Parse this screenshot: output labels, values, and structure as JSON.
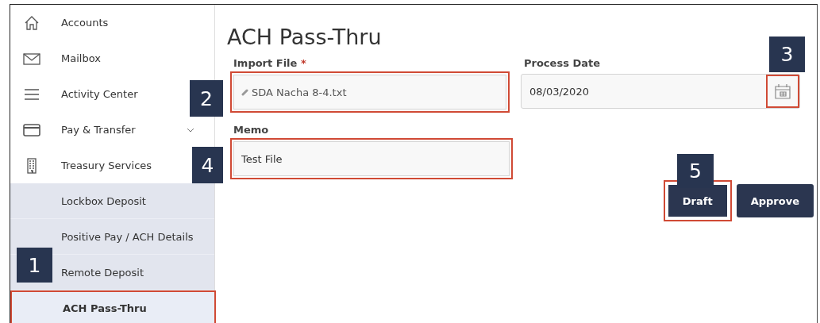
{
  "sidebar": {
    "items": [
      {
        "label": "Accounts",
        "selected": false,
        "highlighted": false
      },
      {
        "label": "Mailbox",
        "selected": false,
        "highlighted": false
      },
      {
        "label": "Activity Center",
        "selected": false,
        "highlighted": false
      },
      {
        "label": "Pay & Transfer",
        "selected": false,
        "highlighted": false,
        "expanded": false
      },
      {
        "label": "Treasury Services",
        "selected": false,
        "highlighted": false,
        "expanded": true,
        "children": [
          {
            "label": "Lockbox Deposit",
            "selected": false,
            "highlighted": false
          },
          {
            "label": "Positive Pay / ACH Details",
            "selected": false,
            "highlighted": false
          },
          {
            "label": "Remote Deposit",
            "selected": false,
            "highlighted": false
          },
          {
            "label": "ACH Pass-Thru",
            "selected": true,
            "highlighted": true
          }
        ]
      }
    ]
  },
  "page": {
    "title": "ACH Pass-Thru"
  },
  "form": {
    "import_file": {
      "label": "Import File",
      "required_mark": "*",
      "value": "SDA Nacha 8-4.txt",
      "highlighted": true
    },
    "process_date": {
      "label": "Process Date",
      "value": "08/03/2020",
      "highlighted": false,
      "calendar_highlighted": true
    },
    "memo": {
      "label": "Memo",
      "value": "Test File",
      "highlighted": true
    }
  },
  "buttons": [
    {
      "label": "Draft",
      "highlighted": true
    },
    {
      "label": "Approve",
      "highlighted": false
    }
  ],
  "callouts": [
    {
      "label": "1"
    },
    {
      "label": "2"
    },
    {
      "label": "3"
    },
    {
      "label": "4"
    },
    {
      "label": "5"
    }
  ]
}
